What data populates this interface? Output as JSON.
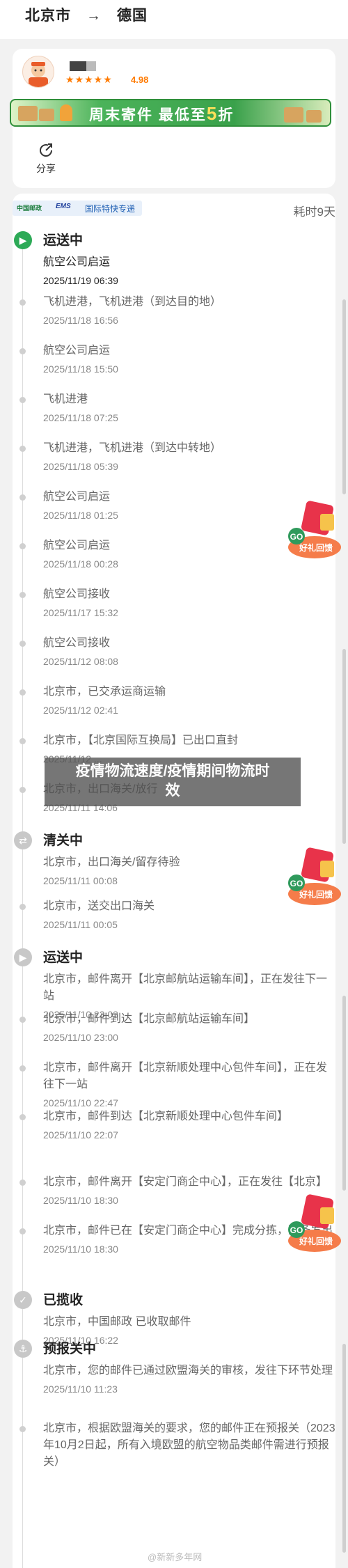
{
  "header": {
    "origin": "北京市",
    "arrow": "→",
    "destination": "德国"
  },
  "sender": {
    "rating": "4.98",
    "stars": "★★★★★"
  },
  "banner": {
    "text_before": "周末寄件 最低至",
    "discount": "5",
    "text_after": "折"
  },
  "share": {
    "label": "分享"
  },
  "carrier": {
    "logo_cn": "中国邮政",
    "logo_ems": "EMS",
    "label": "国际特快专递"
  },
  "eta": "耗时9天",
  "overlay": {
    "line1": "疫情物流速度/疫情期间物流时",
    "line2": "效"
  },
  "badge_text": "好礼回馈",
  "badge_go": "GO",
  "watermark": "@新新多年网",
  "events": [
    {
      "status": "运送中",
      "desc": "航空公司启运",
      "time": "2025/11/19 06:39"
    },
    {
      "desc": "飞机进港，飞机进港（到达目的地）",
      "time": "2025/11/18 16:56"
    },
    {
      "desc": "航空公司启运",
      "time": "2025/11/18 15:50"
    },
    {
      "desc": "飞机进港",
      "time": "2025/11/18 07:25"
    },
    {
      "desc": "飞机进港，飞机进港（到达中转地）",
      "time": "2025/11/18 05:39"
    },
    {
      "desc": "航空公司启运",
      "time": "2025/11/18 01:25"
    },
    {
      "desc": "航空公司启运",
      "time": "2025/11/18 00:28"
    },
    {
      "desc": "航空公司接收",
      "time": "2025/11/17 15:32"
    },
    {
      "desc": "航空公司接收",
      "time": "2025/11/12 08:08"
    },
    {
      "desc": "北京市，已交承运商运输",
      "time": "2025/11/12 02:41"
    },
    {
      "desc": "北京市，【北京国际互换局】已出口直封",
      "time": "2025/11/12 ..."
    },
    {
      "desc": "北京市，出口海关/放行",
      "time": "2025/11/11 14:06"
    },
    {
      "status": "清关中",
      "desc": "北京市，出口海关/留存待验",
      "time": "2025/11/11 00:08"
    },
    {
      "desc": "北京市，送交出口海关",
      "time": "2025/11/11 00:05"
    },
    {
      "status": "运送中",
      "desc": "北京市，邮件离开【北京邮航站运输车间】，正在发往下一站",
      "time": "2025/11/10 23:03"
    },
    {
      "desc": "北京市，邮件到达【北京邮航站运输车间】",
      "time": "2025/11/10 23:00"
    },
    {
      "desc": "北京市，邮件离开【北京新顺处理中心包件车间】，正在发往下一站",
      "time": "2025/11/10 22:47"
    },
    {
      "desc": "北京市，邮件到达【北京新顺处理中心包件车间】",
      "time": "2025/11/10 22:07"
    },
    {
      "desc": "北京市，邮件离开【安定门商企中心】，正在发往【北京】",
      "time": "2025/11/10 18:30"
    },
    {
      "desc": "北京市，邮件已在【安定门商企中心】完成分拣，准备发出",
      "time": "2025/11/10 18:30"
    },
    {
      "status": "已揽收",
      "desc": "北京市，中国邮政 已收取邮件",
      "time": "2025/11/10 16:22"
    },
    {
      "status": "预报关中",
      "desc": "北京市，您的邮件已通过欧盟海关的审核，发往下环节处理",
      "time": "2025/11/10 11:23"
    },
    {
      "desc": "北京市，根据欧盟海关的要求，您的邮件正在预报关（2023年10月2日起，所有入境欧盟的航空物品类邮件需进行预报关）",
      "time": ""
    }
  ]
}
